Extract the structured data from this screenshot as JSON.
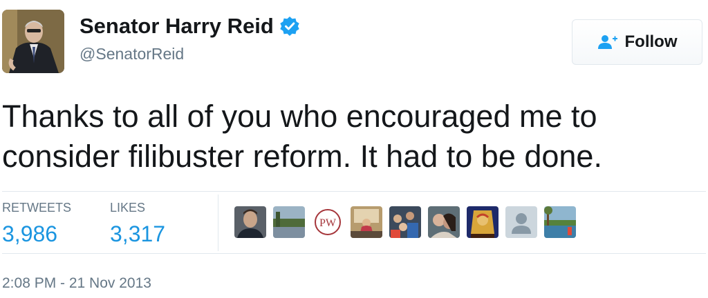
{
  "user": {
    "display_name": "Senator Harry Reid",
    "handle": "@SenatorReid",
    "verified": true,
    "avatar_icon": "user-avatar-photo"
  },
  "follow_button": {
    "label": "Follow",
    "icon": "add-user-icon"
  },
  "tweet": {
    "text": "Thanks to all of you who encouraged me to consider filibuster reform. It had to be done."
  },
  "stats": {
    "retweets_label": "RETWEETS",
    "retweets_value": "3,986",
    "likes_label": "LIKES",
    "likes_value": "3,317"
  },
  "likers": [
    {
      "icon": "liker-avatar-1"
    },
    {
      "icon": "liker-avatar-2"
    },
    {
      "icon": "liker-avatar-3",
      "badge_text": "PW"
    },
    {
      "icon": "liker-avatar-4"
    },
    {
      "icon": "liker-avatar-5"
    },
    {
      "icon": "liker-avatar-6"
    },
    {
      "icon": "liker-avatar-7"
    },
    {
      "icon": "default-avatar-icon"
    },
    {
      "icon": "liker-avatar-9"
    }
  ],
  "timestamp": "2:08 PM - 21 Nov 2013",
  "colors": {
    "link_blue": "#1b95e0",
    "verified_blue": "#1da1f2",
    "secondary_text": "#657786",
    "divider": "#e1e8ed"
  }
}
